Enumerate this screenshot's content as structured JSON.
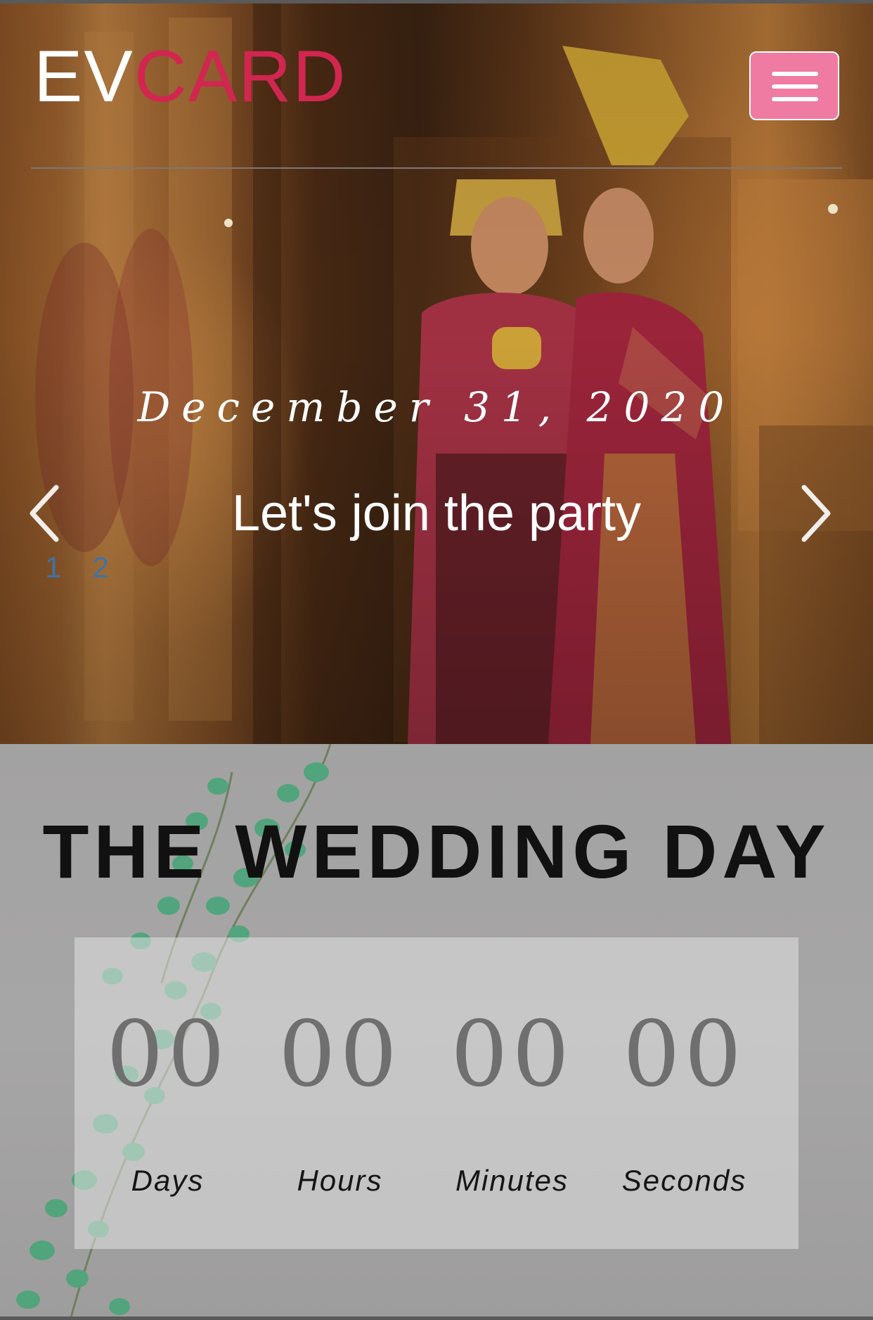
{
  "header": {
    "logo_part1": "EV",
    "logo_part2": "CARD",
    "menu_icon": "hamburger-menu-icon"
  },
  "hero_slider": {
    "date": "December 31, 2020",
    "caption": "Let's join the party",
    "prev_icon": "chevron-left-icon",
    "next_icon": "chevron-right-icon",
    "pages": [
      "1",
      "2"
    ]
  },
  "wedding_day": {
    "title": "THE WEDDING DAY",
    "countdown": {
      "days": {
        "value": "00",
        "label": "Days"
      },
      "hours": {
        "value": "00",
        "label": "Hours"
      },
      "minutes": {
        "value": "00",
        "label": "Minutes"
      },
      "seconds": {
        "value": "00",
        "label": "Seconds"
      }
    }
  },
  "colors": {
    "brand_accent": "#d1264f",
    "menu_button": "#ef7aa2",
    "pager_dots": "#3f73a8"
  }
}
